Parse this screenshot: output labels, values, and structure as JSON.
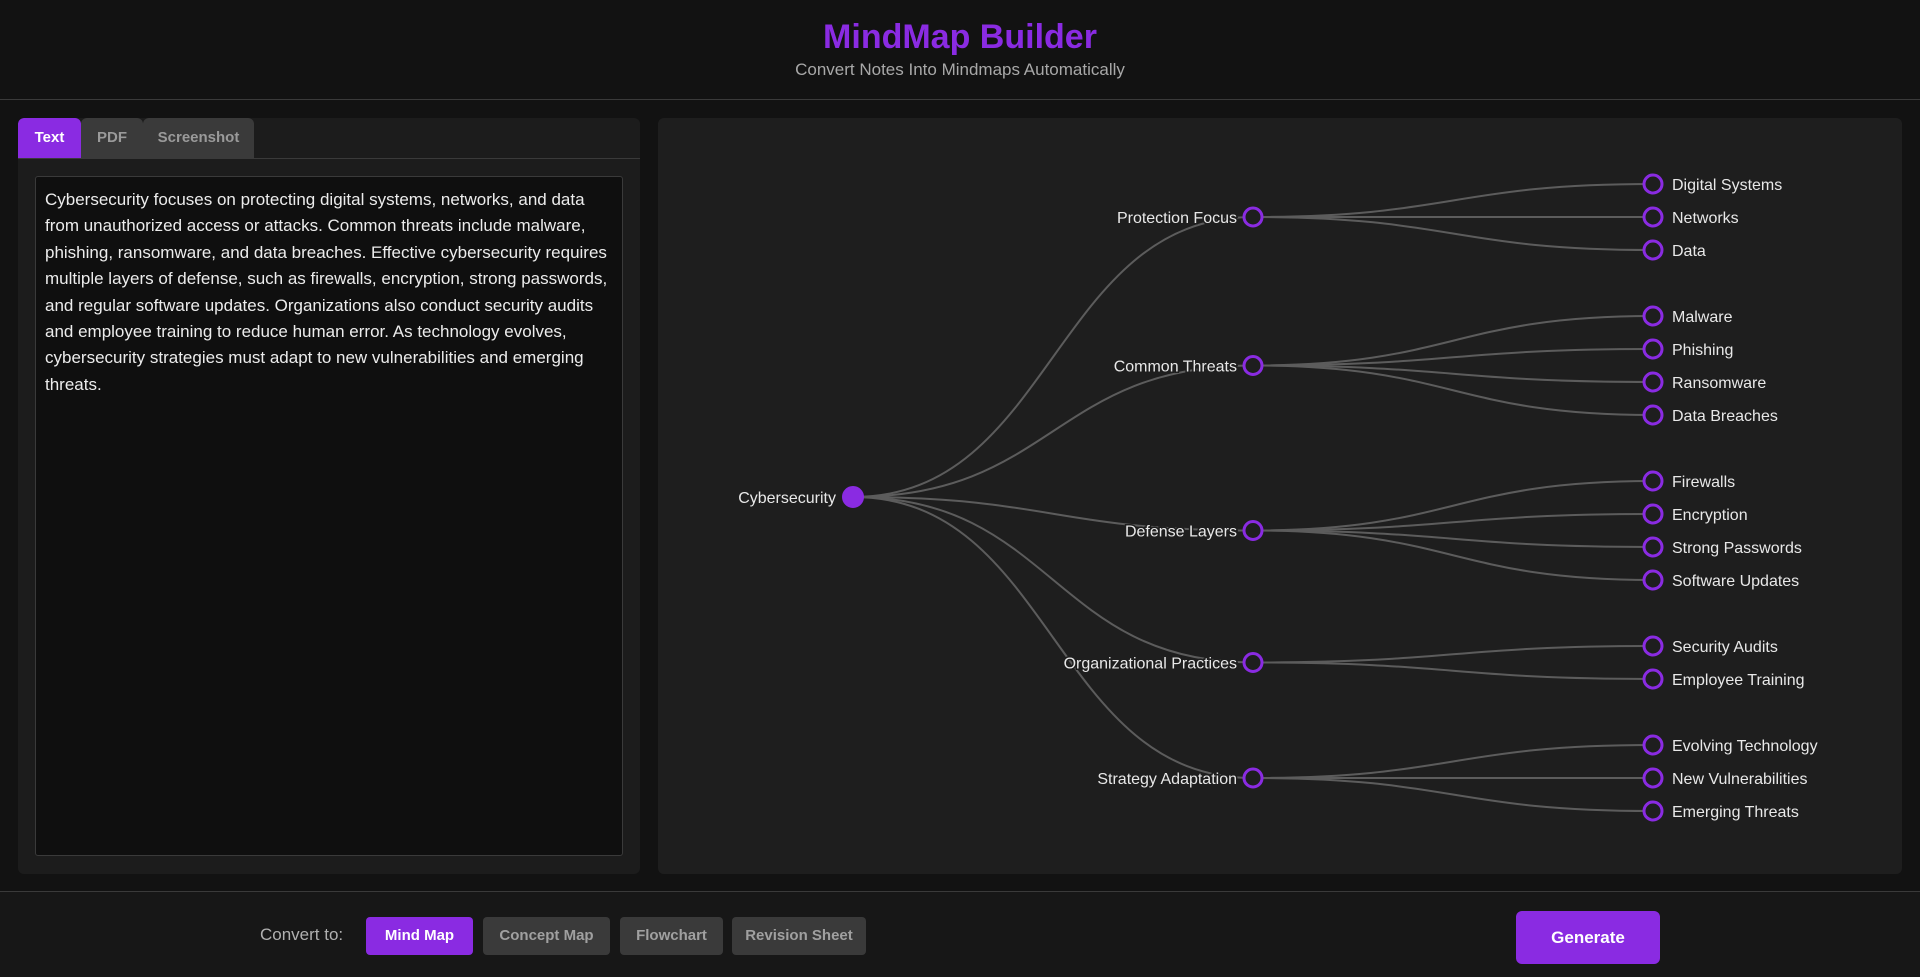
{
  "header": {
    "title": "MindMap Builder",
    "subtitle": "Convert Notes Into Mindmaps Automatically"
  },
  "input": {
    "tabs": [
      {
        "label": "Text",
        "active": true
      },
      {
        "label": "PDF",
        "active": false
      },
      {
        "label": "Screenshot",
        "active": false
      }
    ],
    "notes": "Cybersecurity focuses on protecting digital systems, networks, and data from unauthorized access or attacks. Common threats include malware, phishing, ransomware, and data breaches. Effective cybersecurity requires multiple layers of defense, such as firewalls, encryption, strong passwords, and regular software updates. Organizations also conduct security audits and employee training to reduce human error. As technology evolves, cybersecurity strategies must adapt to new vulnerabilities and emerging threats."
  },
  "mindmap": {
    "root": "Cybersecurity",
    "branches": [
      {
        "label": "Protection Focus",
        "children": [
          "Digital Systems",
          "Networks",
          "Data"
        ]
      },
      {
        "label": "Common Threats",
        "children": [
          "Malware",
          "Phishing",
          "Ransomware",
          "Data Breaches"
        ]
      },
      {
        "label": "Defense Layers",
        "children": [
          "Firewalls",
          "Encryption",
          "Strong Passwords",
          "Software Updates"
        ]
      },
      {
        "label": "Organizational Practices",
        "children": [
          "Security Audits",
          "Employee Training"
        ]
      },
      {
        "label": "Strategy Adaptation",
        "children": [
          "Evolving Technology",
          "New Vulnerabilities",
          "Emerging Threats"
        ]
      }
    ]
  },
  "footer": {
    "convert_label": "Convert to:",
    "formats": [
      {
        "label": "Mind Map",
        "active": true
      },
      {
        "label": "Concept Map",
        "active": false
      },
      {
        "label": "Flowchart",
        "active": false
      },
      {
        "label": "Revision Sheet",
        "active": false
      }
    ],
    "generate_label": "Generate"
  },
  "colors": {
    "accent": "#8a2be2",
    "link": "#5c5c5c",
    "background": "#121212",
    "panel": "#1e1e1e"
  }
}
